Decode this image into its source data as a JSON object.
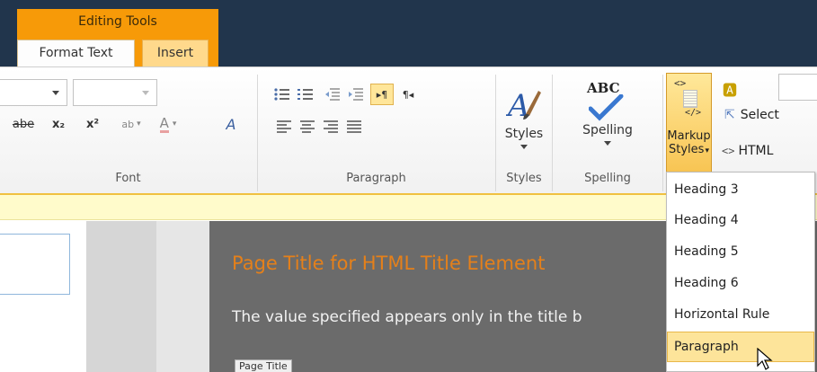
{
  "header": {
    "context_group": "Editing Tools",
    "tabs": [
      {
        "label": "Format Text",
        "selected": true
      },
      {
        "label": "Insert",
        "selected": false
      }
    ]
  },
  "ribbon": {
    "font": {
      "label": "Font",
      "strike_label": "abe",
      "subscript_label": "x₂",
      "superscript_label": "x²",
      "highlight_label": "ab",
      "font_color_label": "A",
      "clear_format_label": "A"
    },
    "paragraph": {
      "label": "Paragraph"
    },
    "styles": {
      "label": "Styles",
      "button_label": "Styles"
    },
    "spelling": {
      "label": "Spelling",
      "button_label": "Spelling",
      "icon_text": "ABC"
    },
    "markup": {
      "button_line1": "Markup",
      "button_line2": "Styles",
      "icon_text": "</>",
      "select_label": "Select",
      "html_label": "HTML"
    }
  },
  "page": {
    "title": "Page Title for HTML Title Element",
    "description": "The value specified appears only in the title b",
    "title_button": "Page Title"
  },
  "dropdown": {
    "items": [
      {
        "label": "Heading 3",
        "highlighted": false
      },
      {
        "label": "Heading 4",
        "highlighted": false
      },
      {
        "label": "Heading 5",
        "highlighted": false
      },
      {
        "label": "Heading 6",
        "highlighted": false
      },
      {
        "label": "Horizontal Rule",
        "highlighted": false
      },
      {
        "label": "Paragraph",
        "highlighted": true
      }
    ]
  },
  "colors": {
    "header_bg": "#21354c",
    "context_orange": "#f79a08",
    "title_orange": "#e5801a",
    "highlight": "#fde49a"
  }
}
